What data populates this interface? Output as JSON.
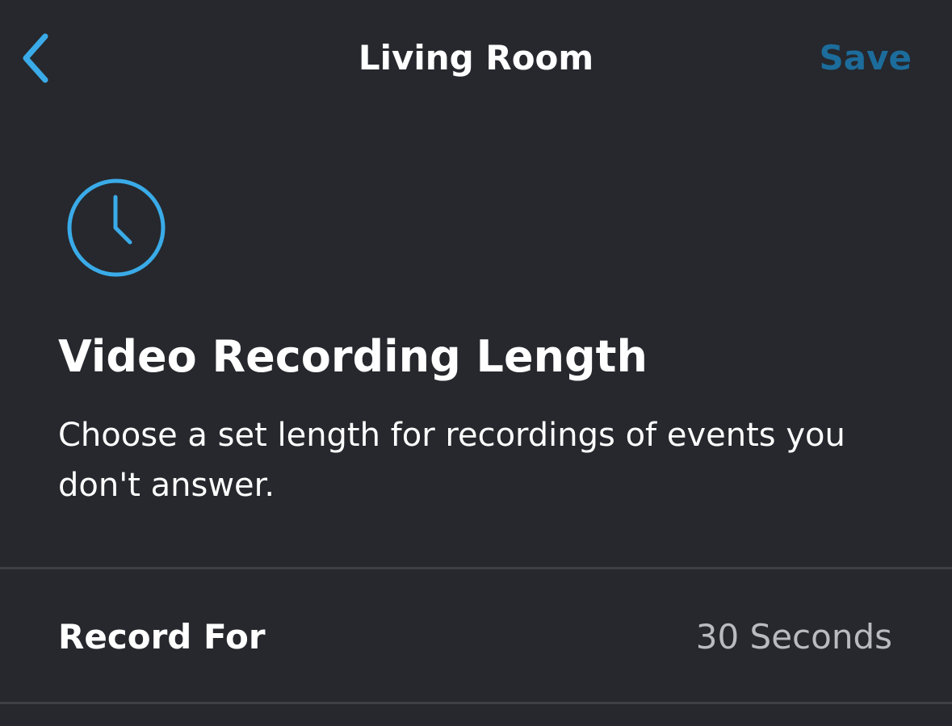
{
  "header": {
    "back_icon": "chevron-left-icon",
    "title": "Living Room",
    "save_label": "Save"
  },
  "section": {
    "icon": "clock-icon",
    "heading": "Video Recording Length",
    "description": "Choose a set length for recordings of events you don't answer."
  },
  "settings": {
    "record_for": {
      "label": "Record For",
      "value": "30 Seconds"
    }
  },
  "colors": {
    "background": "#26282d",
    "accent": "#3aabe8",
    "save_text": "#1c6c9c",
    "primary_text": "#ffffff",
    "secondary_text": "#b9bbc0",
    "divider": "#3e4046"
  }
}
